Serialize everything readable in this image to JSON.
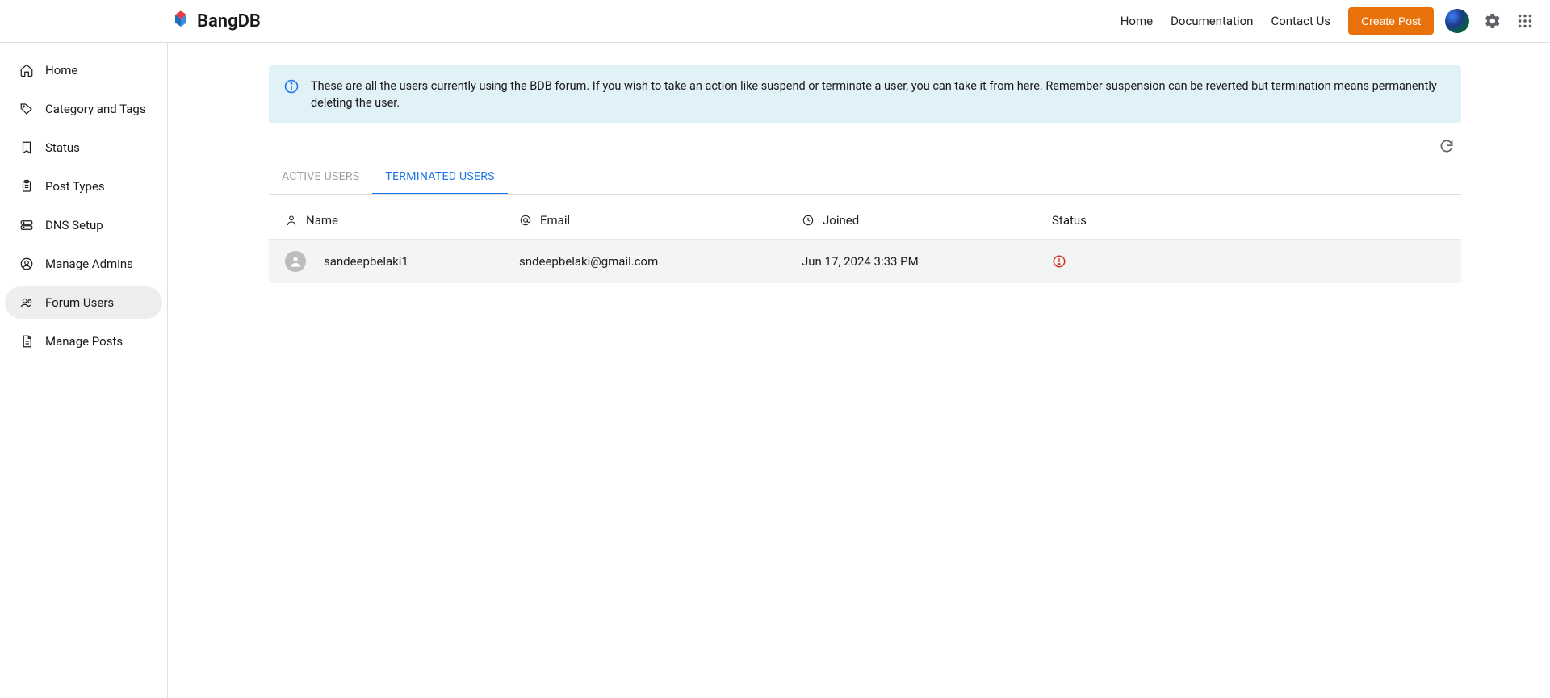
{
  "header": {
    "brand": "BangDB",
    "nav": {
      "home": "Home",
      "docs": "Documentation",
      "contact": "Contact Us"
    },
    "create_post": "Create Post"
  },
  "sidebar": {
    "items": [
      {
        "label": "Home"
      },
      {
        "label": "Category and Tags"
      },
      {
        "label": "Status"
      },
      {
        "label": "Post Types"
      },
      {
        "label": "DNS Setup"
      },
      {
        "label": "Manage Admins"
      },
      {
        "label": "Forum Users"
      },
      {
        "label": "Manage Posts"
      }
    ]
  },
  "banner": {
    "text": "These are all the users currently using the BDB forum. If you wish to take an action like suspend or terminate a user, you can take it from here. Remember suspension can be reverted but termination means permanently deleting the user."
  },
  "tabs": {
    "active": "ACTIVE USERS",
    "terminated": "TERMINATED USERS"
  },
  "table": {
    "headers": {
      "name": "Name",
      "email": "Email",
      "joined": "Joined",
      "status": "Status"
    },
    "rows": [
      {
        "name": "sandeepbelaki1",
        "email": "sndeepbelaki@gmail.com",
        "joined": "Jun 17, 2024 3:33 PM"
      }
    ]
  }
}
